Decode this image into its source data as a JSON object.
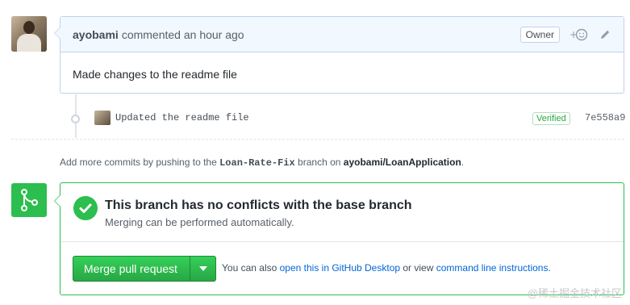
{
  "comment": {
    "author": "ayobami",
    "action_text": "commented",
    "time": "an hour ago",
    "owner_badge": "Owner",
    "body": "Made changes to the readme file",
    "reaction_icon": "smiley-plus-icon",
    "edit_icon": "pencil-icon"
  },
  "commit": {
    "message": "Updated the readme file",
    "verified_label": "Verified",
    "sha": "7e558a9",
    "icon": "git-commit-icon"
  },
  "push_note": {
    "prefix": "Add more commits by pushing to the ",
    "branch": "Loan-Rate-Fix",
    "middle": " branch on ",
    "repo": "ayobami/LoanApplication",
    "suffix": "."
  },
  "merge": {
    "icon": "git-merge-icon",
    "status_icon": "check-icon",
    "title": "This branch has no conflicts with the base branch",
    "subtitle": "Merging can be performed automatically.",
    "button_label": "Merge pull request",
    "hint_prefix": "You can also ",
    "hint_link_desktop": "open this in GitHub Desktop",
    "hint_middle": " or view ",
    "hint_link_cli": "command line instructions",
    "hint_suffix": "."
  },
  "watermark": "@稀土掘金技术社区",
  "colors": {
    "accent_green": "#2cbe4e",
    "link_blue": "#0366d6",
    "header_bg": "#f1f8ff"
  }
}
